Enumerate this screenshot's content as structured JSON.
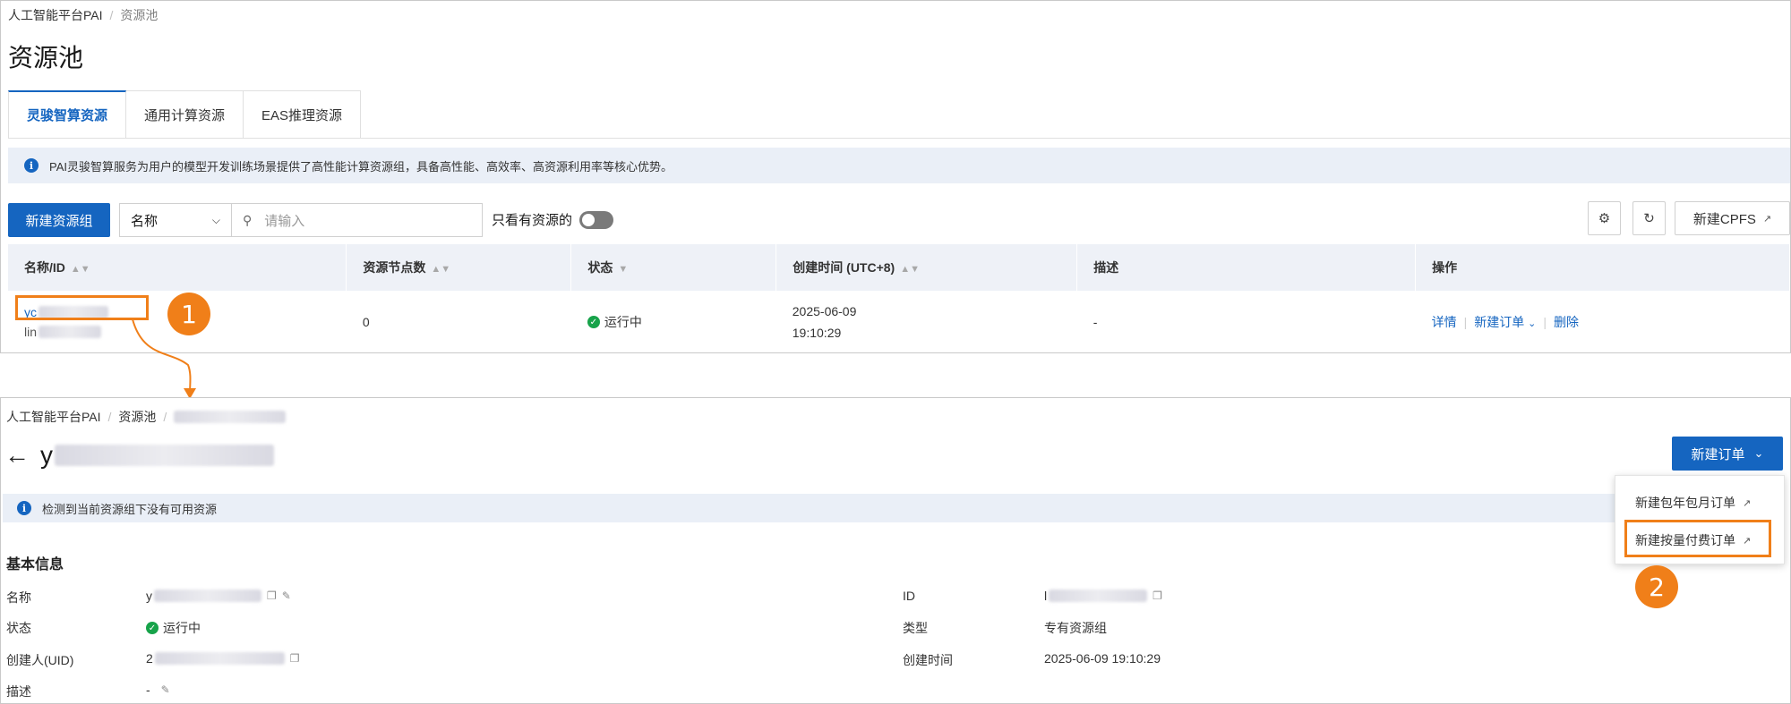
{
  "top": {
    "breadcrumb": {
      "root": "人工智能平台PAI",
      "current": "资源池"
    },
    "title": "资源池",
    "tabs": [
      {
        "label": "灵骏智算资源",
        "active": true
      },
      {
        "label": "通用计算资源",
        "active": false
      },
      {
        "label": "EAS推理资源",
        "active": false
      }
    ],
    "info": "PAI灵骏智算服务为用户的模型开发训练场景提供了高性能计算资源组，具备高性能、高效率、高资源利用率等核心优势。",
    "toolbar": {
      "create_label": "新建资源组",
      "filter_select": "名称",
      "search_placeholder": "请输入",
      "only_with_resources": "只看有资源的",
      "create_cpfs": "新建CPFS"
    },
    "table": {
      "headers": [
        "名称/ID",
        "资源节点数",
        "状态",
        "创建时间 (UTC+8)",
        "描述",
        "操作"
      ],
      "row": {
        "name_prefix": "yc",
        "id_prefix": "lin",
        "nodes": "0",
        "status": "运行中",
        "created_date": "2025-06-09",
        "created_time": "19:10:29",
        "description": "-",
        "actions": {
          "detail": "详情",
          "new_order": "新建订单",
          "delete": "删除"
        }
      }
    },
    "step_badge": "1"
  },
  "bottom": {
    "breadcrumb": {
      "root": "人工智能平台PAI",
      "pool": "资源池"
    },
    "title_prefix": "y",
    "new_order_button": "新建订单",
    "warning": "检测到当前资源组下没有可用资源",
    "section_title": "基本信息",
    "fields": {
      "name_label": "名称",
      "name_value_prefix": "y",
      "status_label": "状态",
      "status_value": "运行中",
      "creator_label": "创建人(UID)",
      "creator_value_prefix": "2",
      "desc_label": "描述",
      "desc_value": "-",
      "id_label": "ID",
      "id_value_prefix": "l",
      "type_label": "类型",
      "type_value": "专有资源组",
      "created_label": "创建时间",
      "created_value": "2025-06-09 19:10:29"
    },
    "dropdown": {
      "subscription": "新建包年包月订单",
      "pay_as_you_go": "新建按量付费订单"
    },
    "step_badge": "2"
  },
  "colors": {
    "primary": "#1565c0",
    "callout": "#f07f19",
    "success": "#17a34a"
  }
}
